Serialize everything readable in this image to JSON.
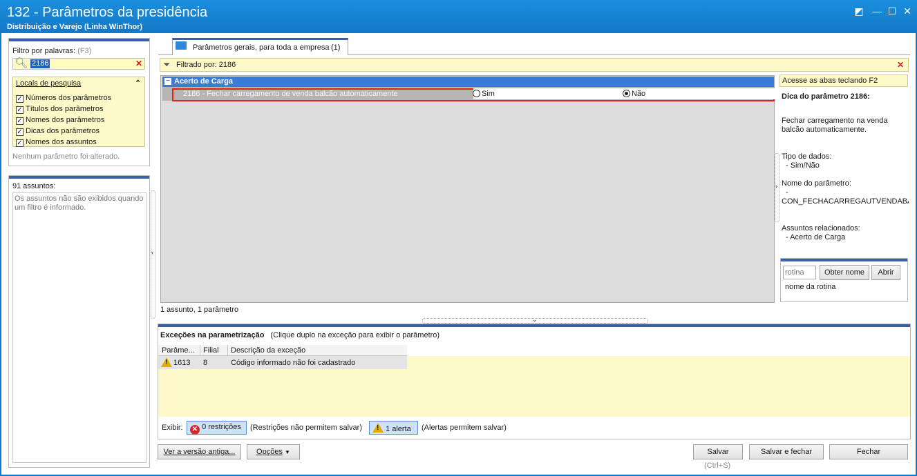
{
  "window": {
    "title": "132 - Parâmetros da presidência",
    "subtitle": "Distribuição e Varejo (Linha WinThor)",
    "controls": [
      "◩",
      "—",
      "☐",
      "✕"
    ]
  },
  "filter_panel": {
    "label": "Filtro por palavras:",
    "shortcut": "(F3)",
    "search_value": "2186",
    "clear_glyph": "✕",
    "locations_title": "Locais de pesquisa",
    "collapse_glyph": "⌃",
    "options": [
      {
        "label": "Números dos parâmetros",
        "checked": true
      },
      {
        "label": "Títulos dos parâmetros",
        "checked": true
      },
      {
        "label": "Nomes dos parâmetros",
        "checked": true
      },
      {
        "label": "Dicas dos parâmetros",
        "checked": true
      },
      {
        "label": "Nomes dos assuntos",
        "checked": true
      }
    ],
    "status": "Nenhum parâmetro foi alterado."
  },
  "subjects_panel": {
    "count_label": "91 assuntos:",
    "message": "Os assuntos não são exibidos quando um filtro é informado."
  },
  "tab": {
    "label": "Parâmetros gerais, para toda a empresa",
    "count": "(1)"
  },
  "filter_bar": {
    "text": "Filtrado por: 2186",
    "close_glyph": "✕"
  },
  "grid": {
    "group_toggle": "−",
    "group_name": "Acerto de Carga",
    "param_label": "2186 - Fechar carregamento de venda balcão automaticamente",
    "option_yes": "Sim",
    "option_no": "Não",
    "selected": "Não",
    "footer": "1 assunto, 1 parâmetro"
  },
  "tip": {
    "header": "Acesse as abas teclando F2",
    "title": "Dica do parâmetro 2186:",
    "description": "Fechar carregamento na venda balcão automaticamente.",
    "data_type_label": "Tipo de dados:",
    "data_type_value": "- Sim/Não",
    "param_name_label": "Nome do parâmetro:",
    "param_name_dash": "-",
    "param_name_value": "CON_FECHACARREGAUTVENDABALCA",
    "related_label": "Assuntos relacionados:",
    "related_value": "- Acerto de Carga"
  },
  "routine": {
    "placeholder": "rotina",
    "get_name_button": "Obter nome",
    "open_button": "Abrir",
    "name_label": "nome da rotina"
  },
  "exceptions": {
    "title": "Exceções na parametrização",
    "hint": "(Clique duplo na exceção para exibir o parâmetro)",
    "columns": [
      "Parâme...",
      "Filial",
      "Descrição da exceção"
    ],
    "rows": [
      {
        "param": "1613",
        "branch": "8",
        "description": "Código informado não foi cadastrado"
      }
    ],
    "show_label": "Exibir:",
    "restrictions_button": "0 restrições",
    "restrictions_note": "(Restrições não permitem salvar)",
    "alerts_button": "1 alerta",
    "alerts_note": "(Alertas permitem salvar)"
  },
  "footer": {
    "old_version_button": "Ver a versão antiga...",
    "options_button": "Opções",
    "save_button": "Salvar",
    "save_shortcut": "(Ctrl+S)",
    "save_close_button": "Salvar e fechar",
    "close_button": "Fechar"
  },
  "colors": {
    "titlebar": "#1478c8",
    "highlight_border": "#e0201a",
    "group_row": "#3a7bd5",
    "info_yellow": "#fdf9c8"
  }
}
